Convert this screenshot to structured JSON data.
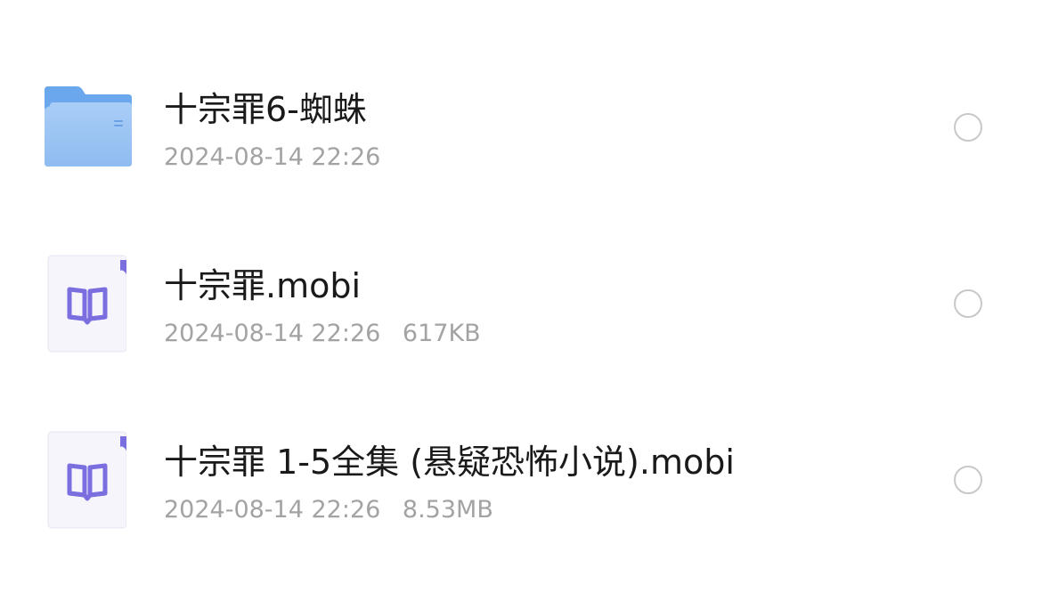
{
  "files": [
    {
      "name": "十宗罪6-蜘蛛",
      "date": "2024-08-14 22:26",
      "size": "",
      "icon": "folder-icon",
      "icon_color": "#7bb1f0"
    },
    {
      "name": "十宗罪.mobi",
      "date": "2024-08-14 22:26",
      "size": "617KB",
      "icon": "ebook-icon",
      "icon_color": "#7b6fe0"
    },
    {
      "name": "十宗罪 1-5全集 (悬疑恐怖小说).mobi",
      "date": "2024-08-14 22:26",
      "size": "8.53MB",
      "icon": "ebook-icon",
      "icon_color": "#7b6fe0"
    }
  ],
  "colors": {
    "background": "#ffffff",
    "title_text": "#1a1a1a",
    "meta_text": "#a3a3a3",
    "radio_border": "#c8c8c8",
    "folder_blue": "#7bb1f0",
    "ebook_purple": "#7b6fe0"
  }
}
